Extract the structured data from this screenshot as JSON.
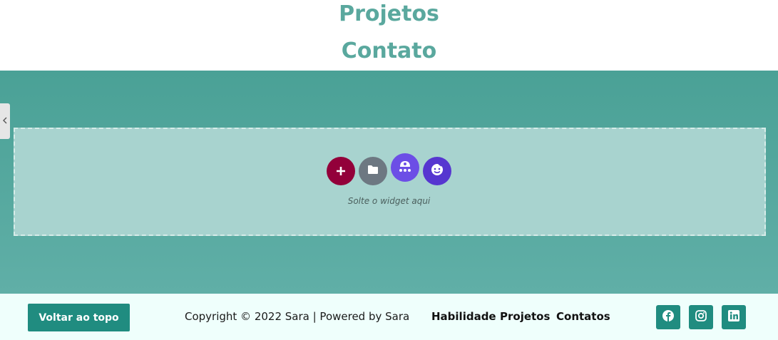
{
  "header": {
    "links": [
      "Projetos",
      "Contato"
    ]
  },
  "editor": {
    "drop_text": "Solte o widget aqui",
    "buttons": {
      "add_icon": "plus-icon",
      "template_icon": "folder-icon",
      "kit_icon": "kit-icon",
      "ai_icon": "ai-face-icon"
    }
  },
  "footer": {
    "back_to_top": "Voltar ao topo",
    "copyright": "Copyright © 2022 Sara | Powered by Sara",
    "nav": [
      "Habilidade",
      "Projetos",
      "Contatos"
    ],
    "social_icons": [
      "facebook-icon",
      "instagram-icon",
      "linkedin-icon"
    ]
  },
  "colors": {
    "heading_teal": "#5aa89e",
    "section_teal": "#4aa196",
    "dropzone": "#a8d3cf",
    "button_teal": "#208c80",
    "add_button": "#93003a",
    "template_button": "#6d7882",
    "kit_button": "#6c4ee6",
    "ai_button": "#5636d0",
    "footer_bg": "#effffc"
  }
}
